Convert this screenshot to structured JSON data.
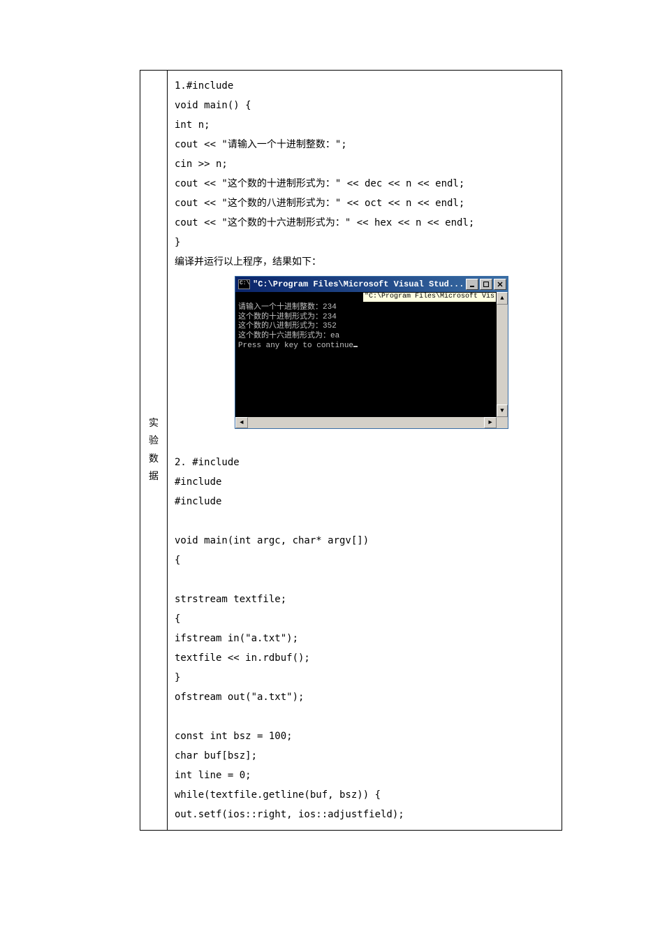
{
  "label_cell": "实\n验\n数\n据",
  "code1": {
    "l1": "1.#include",
    "l2": "void main() {",
    "l3": "int n;",
    "l4": "cout << \"请输入一个十进制整数：\";",
    "l5": "cin >> n;",
    "l6": "cout << \"这个数的十进制形式为：\" << dec << n << endl;",
    "l7": "cout << \"这个数的八进制形式为：\" << oct << n << endl;",
    "l8": "cout << \"这个数的十六进制形式为：\" << hex << n << endl;",
    "l9": "}",
    "l10": "编译并运行以上程序，结果如下："
  },
  "cmd": {
    "title": "\"C:\\Program Files\\Microsoft Visual Stud...",
    "tooltip": "\"C:\\Program Files\\Microsoft Vis",
    "out1": "请输入一个十进制整数：234",
    "out2": "这个数的十进制形式为：234",
    "out3": "这个数的八进制形式为：352",
    "out4": "这个数的十六进制形式为：ea",
    "out5": "Press any key to continue"
  },
  "code2": {
    "l1": "2. #include",
    "l2": "#include",
    "l3": "#include",
    "l4": "",
    "l5": "void main(int argc, char* argv[])",
    "l6": "{",
    "l7": "",
    "l8": "strstream textfile;",
    "l9": "{",
    "l10": "ifstream in(\"a.txt\");",
    "l11": "textfile << in.rdbuf();",
    "l12": "}",
    "l13": "ofstream out(\"a.txt\");",
    "l14": "",
    "l15": "const int bsz = 100;",
    "l16": "char buf[bsz];",
    "l17": "int line = 0;",
    "l18": "while(textfile.getline(buf, bsz)) {",
    "l19": "out.setf(ios::right, ios::adjustfield);"
  }
}
